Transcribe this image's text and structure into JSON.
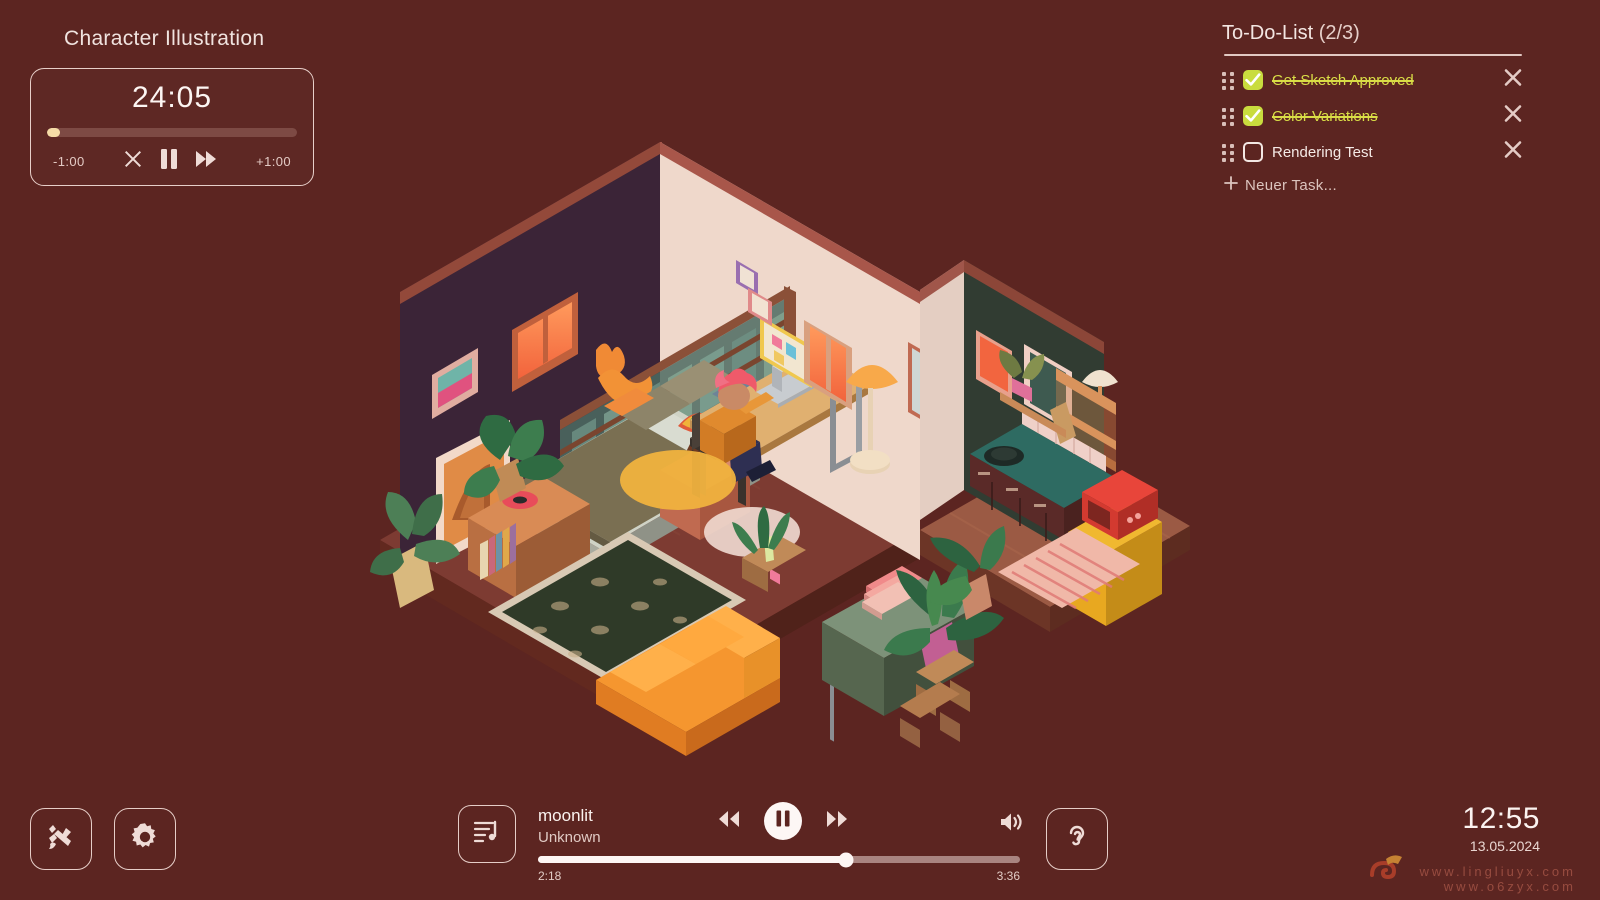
{
  "app": {
    "background_color": "#5c2521",
    "accent_cream": "#f5dba6",
    "accent_green": "#c9dc3e",
    "text_color": "#f5eae6"
  },
  "project": {
    "title": "Character Illustration"
  },
  "timer": {
    "value": "24:05",
    "progress_percent": 5,
    "decrease_label": "-1:00",
    "increase_label": "+1:00",
    "controls": [
      "cancel-icon",
      "pause-icon",
      "skip-forward-icon"
    ]
  },
  "todo": {
    "title": "To-Do-List",
    "count_label": "(2/3)",
    "completed": 2,
    "total": 3,
    "add_label": "Neuer Task...",
    "add_icon": "plus-icon",
    "items": [
      {
        "label": "Get Sketch Approved",
        "done": true,
        "grip": "drag-handle-icon",
        "remove": "close-icon"
      },
      {
        "label": "Color Variations",
        "done": true,
        "grip": "drag-handle-icon",
        "remove": "close-icon"
      },
      {
        "label": "Rendering Test",
        "done": false,
        "grip": "drag-handle-icon",
        "remove": "close-icon"
      }
    ]
  },
  "toolbar": {
    "brush_icon": "paint-brush-icon",
    "settings_icon": "gear-icon",
    "ambient_icon": "ear-icon"
  },
  "player": {
    "album_icon": "music-playlist-icon",
    "track_title": "moonlit",
    "track_artist": "Unknown",
    "elapsed": "2:18",
    "duration": "3:36",
    "progress_percent": 64,
    "prev_icon": "rewind-icon",
    "play_icon": "pause-icon",
    "next_icon": "fast-forward-icon",
    "volume_icon": "volume-icon"
  },
  "clock": {
    "time": "12:55",
    "date": "13.05.2024"
  },
  "watermark": {
    "line1": "www.lingliuyx.com",
    "line2": "www.o6zyx.com"
  },
  "scene": {
    "name": "isometric-cozy-room-illustration",
    "description": "Isometric cutaway apartment: bedroom loft with orange window, desk with character at laptop, living area with persian rug and orange sofa, kitchen with teal counter, red microwave and yellow fridge."
  }
}
